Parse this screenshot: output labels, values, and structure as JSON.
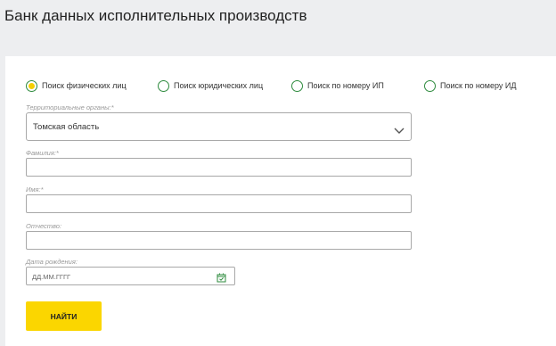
{
  "page": {
    "title": "Банк данных исполнительных производств"
  },
  "search_type": {
    "options": [
      {
        "label": "Поиск физических лиц",
        "selected": true
      },
      {
        "label": "Поиск юридических лиц",
        "selected": false
      },
      {
        "label": "Поиск по номеру ИП",
        "selected": false
      },
      {
        "label": "Поиск по номеру ИД",
        "selected": false
      }
    ]
  },
  "form": {
    "region_label": "Территориальные органы:*",
    "region_value": "Томская область",
    "lastname_label": "Фамилия:*",
    "lastname_value": "",
    "firstname_label": "Имя:*",
    "firstname_value": "",
    "patronymic_label": "Отчество:",
    "patronymic_value": "",
    "birthdate_label": "Дата рождения:",
    "birthdate_placeholder": "ДД.ММ.ГГГГ",
    "submit_label": "НАЙТИ"
  },
  "colors": {
    "accent_yellow": "#fbd600",
    "radio_green": "#2e8b3e",
    "page_background": "#edeef0"
  },
  "icons": {
    "select_chevron": "chevron-down-icon",
    "date_picker": "calendar-check-icon"
  }
}
